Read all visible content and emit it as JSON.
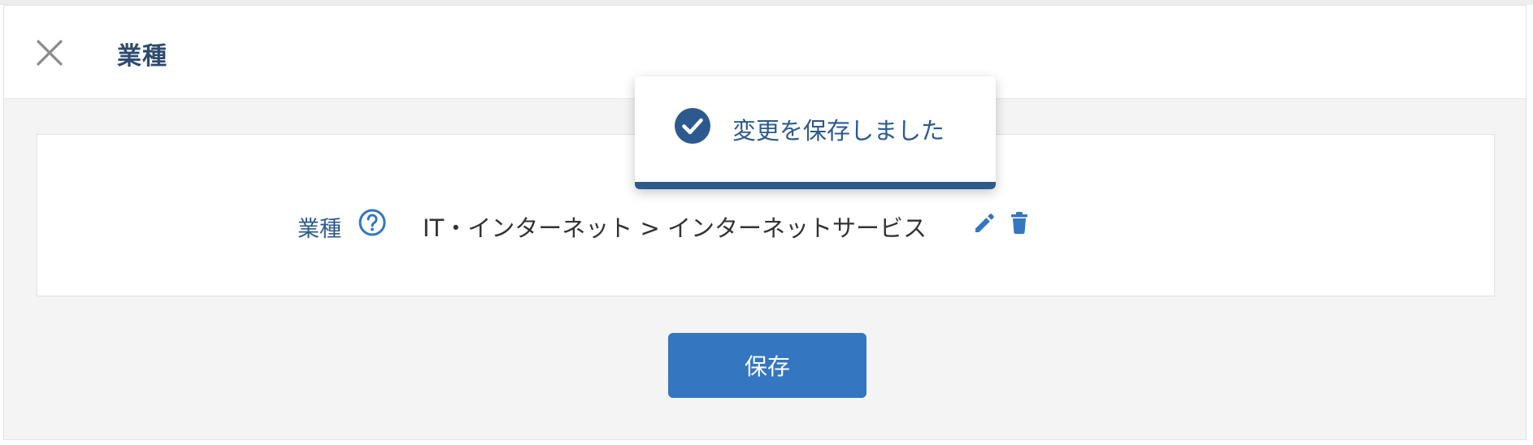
{
  "header": {
    "title": "業種",
    "close_icon": "close-icon"
  },
  "field": {
    "label": "業種",
    "help_icon": "question-circle-icon",
    "value": "IT・インターネット > インターネットサービス",
    "edit_icon": "pencil-icon",
    "delete_icon": "trash-icon"
  },
  "actions": {
    "save_label": "保存"
  },
  "toast": {
    "icon": "check-circle-icon",
    "message": "変更を保存しました"
  },
  "colors": {
    "primary": "#3476bf",
    "title_text": "#2d4a70",
    "label_text": "#2d5a8e",
    "background": "#f4f4f4"
  }
}
